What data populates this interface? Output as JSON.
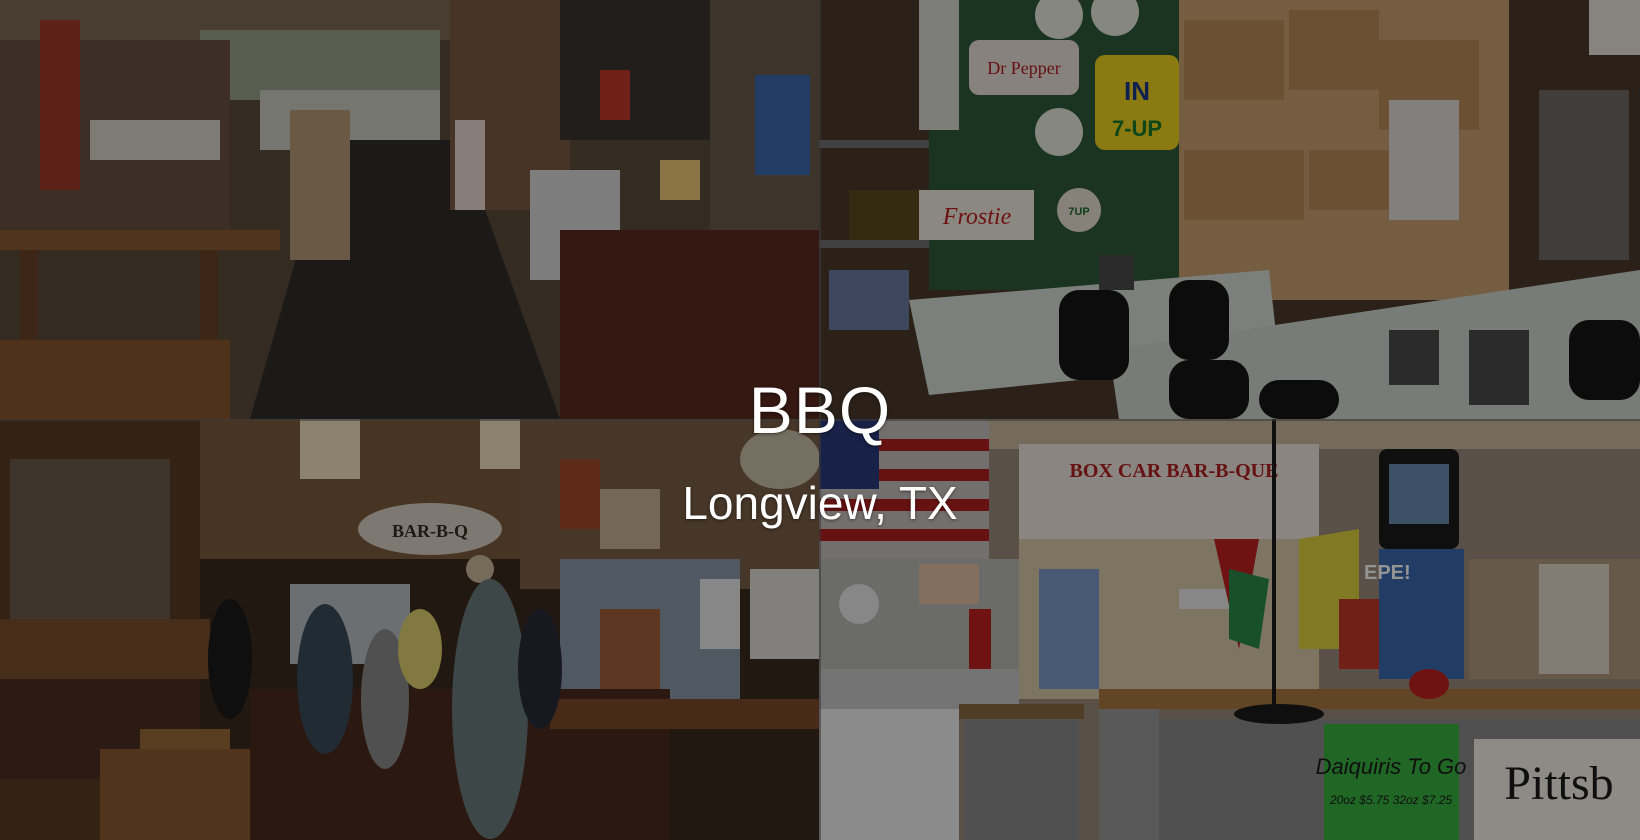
{
  "caption": {
    "title": "BBQ",
    "location": "Longview, TX"
  },
  "signs": {
    "bbq_pig": "BAR-B-Q",
    "menu_board": "BOX CAR BAR-B-QUE",
    "drink_poster": "Daiquiris To Go",
    "drink_prices": "20oz $5.75 32oz $7.25",
    "pittsburg_sign": "Pittsb",
    "dr_pepper": "Dr Pepper",
    "seven_up": "7-UP",
    "seven_up_arrow": "IN",
    "frostie": "Frostie",
    "seven_up_small": "7UP",
    "pepsi": "EPE!"
  },
  "colors": {
    "overlay": "#000000",
    "caption_text": "#ffffff"
  }
}
